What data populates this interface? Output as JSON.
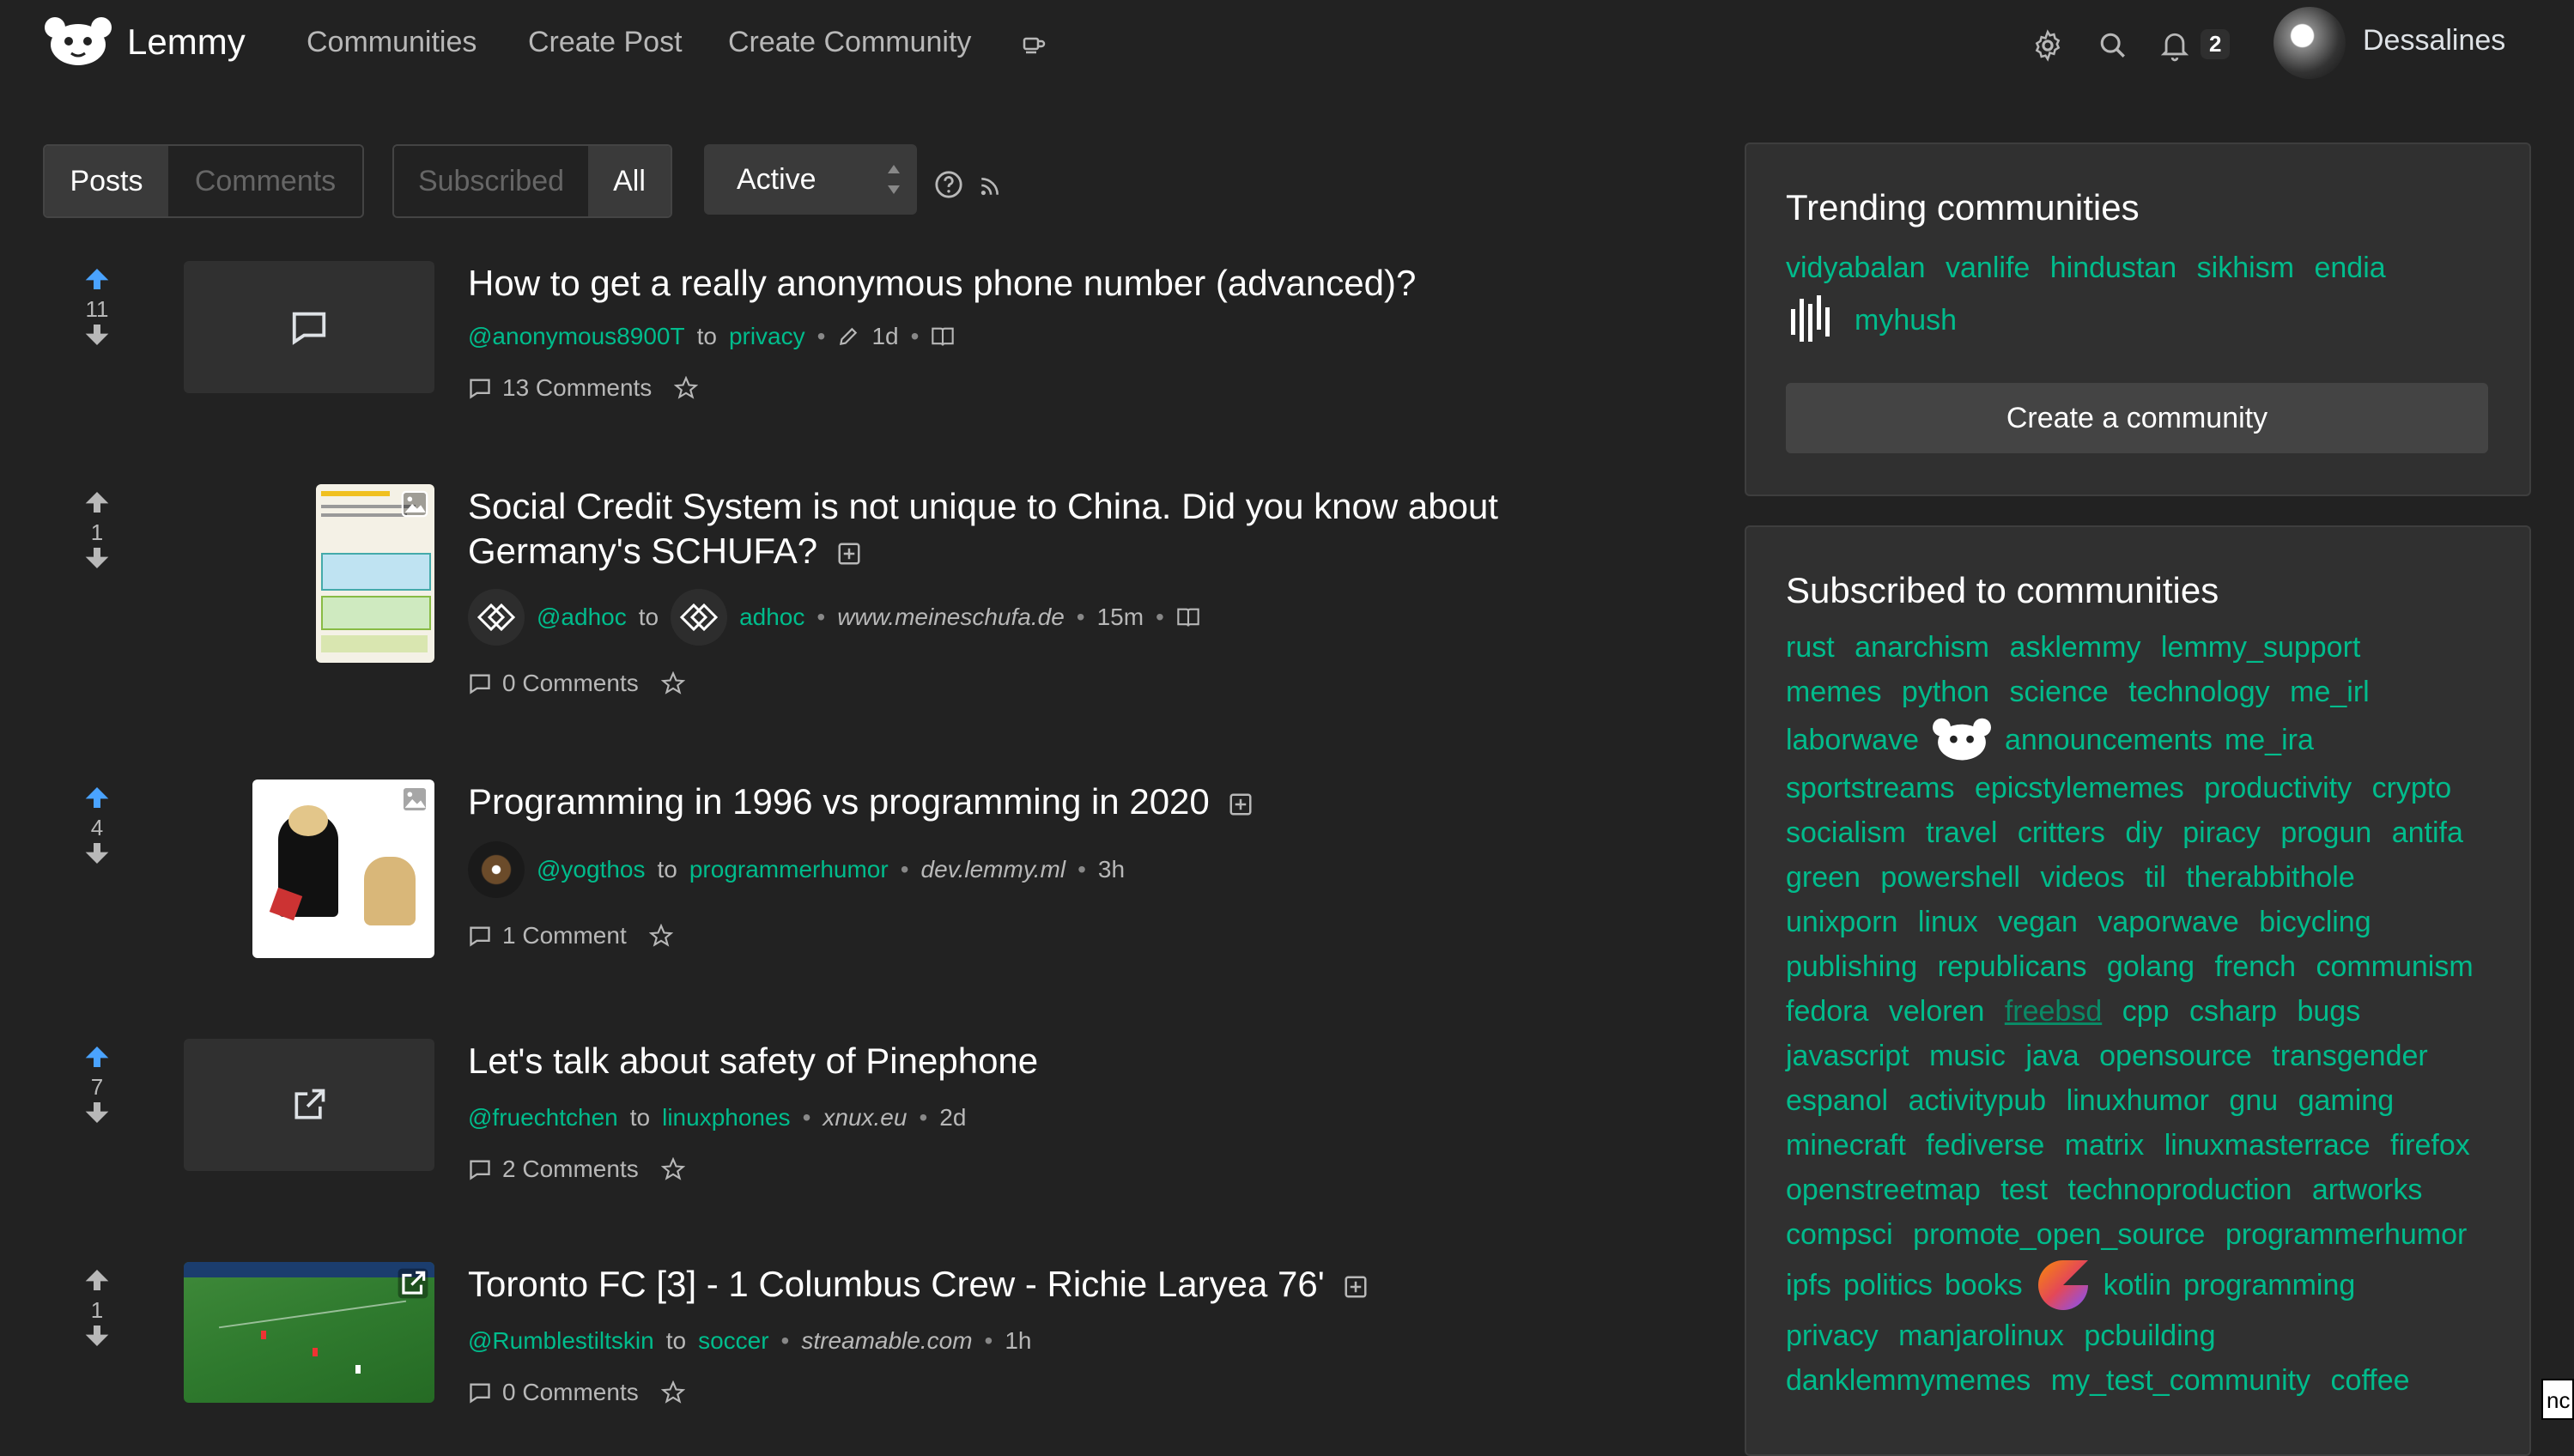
{
  "nav": {
    "brand": "Lemmy",
    "links": [
      "Communities",
      "Create Post",
      "Create Community"
    ],
    "notification_count": "2",
    "username": "Dessalines"
  },
  "filters": {
    "type_options": [
      "Posts",
      "Comments"
    ],
    "type_selected": "Posts",
    "listing_options": [
      "Subscribed",
      "All"
    ],
    "listing_selected": "All",
    "sort": "Active"
  },
  "posts": [
    {
      "score": "11",
      "title": "How to get a really anonymous phone number (advanced)?",
      "user": "@anonymous8900T",
      "to": "to",
      "community": "privacy",
      "time": "1d",
      "comments": "13 Comments",
      "thumb": "text-post"
    },
    {
      "score": "1",
      "title": "Social Credit System is not unique to China. Did you know about Germany's SCHUFA?",
      "user": "@adhoc",
      "to": "to",
      "community": "adhoc",
      "domain": "www.meineschufa.de",
      "time": "15m",
      "comments": "0 Comments",
      "thumb": "image"
    },
    {
      "score": "4",
      "title": "Programming in 1996 vs programming in 2020",
      "user": "@yogthos",
      "to": "to",
      "community": "programmerhumor",
      "domain": "dev.lemmy.ml",
      "time": "3h",
      "comments": "1 Comment",
      "thumb": "image"
    },
    {
      "score": "7",
      "title": "Let's talk about safety of Pinephone",
      "user": "@fruechtchen",
      "to": "to",
      "community": "linuxphones",
      "domain": "xnux.eu",
      "time": "2d",
      "comments": "2 Comments",
      "thumb": "link"
    },
    {
      "score": "1",
      "title": "Toronto FC [3] - 1 Columbus Crew - Richie Laryea 76'",
      "user": "@Rumblestiltskin",
      "to": "to",
      "community": "soccer",
      "domain": "streamable.com",
      "time": "1h",
      "comments": "0 Comments",
      "thumb": "video"
    }
  ],
  "sidebar": {
    "trending_title": "Trending communities",
    "trending": [
      "vidyabalan",
      "vanlife",
      "hindustan",
      "sikhism",
      "endia",
      "myhush"
    ],
    "create_label": "Create a community",
    "subscribed_title": "Subscribed to communities",
    "subscribed_lines": [
      [
        "rust",
        "anarchism",
        "asklemmy",
        "lemmy_support"
      ],
      [
        "memes",
        "python",
        "science",
        "technology",
        "me_irl"
      ],
      [
        "laborwave",
        "announcements",
        "me_ira"
      ],
      [
        "sportstreams",
        "epicstylememes",
        "productivity",
        "crypto"
      ],
      [
        "socialism",
        "travel",
        "critters",
        "diy",
        "piracy",
        "progun",
        "antifa"
      ],
      [
        "green",
        "powershell",
        "videos",
        "til",
        "therabbithole"
      ],
      [
        "unixporn",
        "linux",
        "vegan",
        "vaporwave",
        "bicycling"
      ],
      [
        "publishing",
        "republicans",
        "golang",
        "french",
        "communism"
      ],
      [
        "fedora",
        "veloren",
        "freebsd",
        "cpp",
        "csharp",
        "bugs"
      ],
      [
        "javascript",
        "music",
        "java",
        "opensource",
        "transgender"
      ],
      [
        "espanol",
        "activitypub",
        "linuxhumor",
        "gnu",
        "gaming"
      ],
      [
        "minecraft",
        "fediverse",
        "matrix",
        "linuxmasterrace",
        "firefox"
      ],
      [
        "openstreetmap",
        "test",
        "technoproduction",
        "artworks"
      ],
      [
        "compsci",
        "promote_open_source",
        "programmerhumor"
      ],
      [
        "ipfs",
        "politics",
        "books",
        "kotlin",
        "programming"
      ],
      [
        "privacy",
        "manjarolinux",
        "pcbuilding"
      ],
      [
        "danklemmymemes",
        "my_test_community",
        "coffee"
      ]
    ]
  },
  "colors": {
    "background": "#222222",
    "accent": "#00bc8c",
    "upvote": "#4aa3ff",
    "card": "#303030"
  },
  "tooltip_fragment": "nc"
}
